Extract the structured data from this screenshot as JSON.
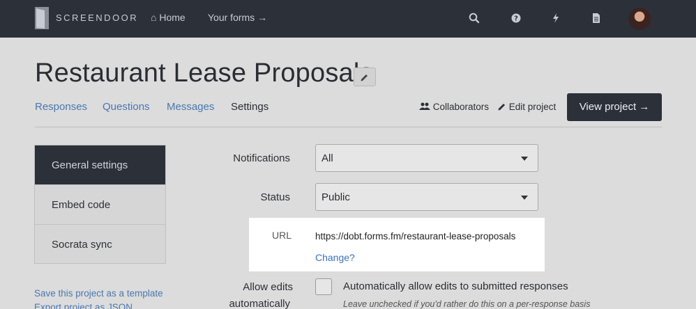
{
  "nav": {
    "brand": "SCREENDOOR",
    "home": "Home",
    "your_forms": "Your forms →",
    "icons": [
      "search-icon",
      "help-icon",
      "bolt-icon",
      "document-icon"
    ]
  },
  "project": {
    "title": "Restaurant Lease Proposals"
  },
  "tabs": [
    {
      "label": "Responses"
    },
    {
      "label": "Questions"
    },
    {
      "label": "Messages"
    },
    {
      "label": "Settings"
    }
  ],
  "actions": {
    "collaborators": "Collaborators",
    "edit_project": "Edit project",
    "view_project": "View project →"
  },
  "sidebar": {
    "items": [
      {
        "label": "General settings"
      },
      {
        "label": "Embed code"
      },
      {
        "label": "Socrata sync"
      }
    ],
    "links": [
      {
        "label": "Save this project as a template"
      },
      {
        "label": "Export project as JSON"
      }
    ]
  },
  "settings": {
    "notifications": {
      "label": "Notifications",
      "value": "All"
    },
    "status": {
      "label": "Status",
      "value": "Public"
    },
    "url": {
      "label": "URL",
      "value": "https://dobt.forms.fm/restaurant-lease-proposals",
      "change": "Change?"
    },
    "allow_edits": {
      "label_line1": "Allow edits",
      "label_line2": "automatically",
      "checkbox_label": "Automatically allow edits to submitted responses",
      "hint": "Leave unchecked if you'd rather do this on a per-response basis"
    }
  },
  "colors": {
    "navbar": "#2c3039",
    "link": "#4a78b0",
    "overlay_bg": "#dcdcdc"
  }
}
